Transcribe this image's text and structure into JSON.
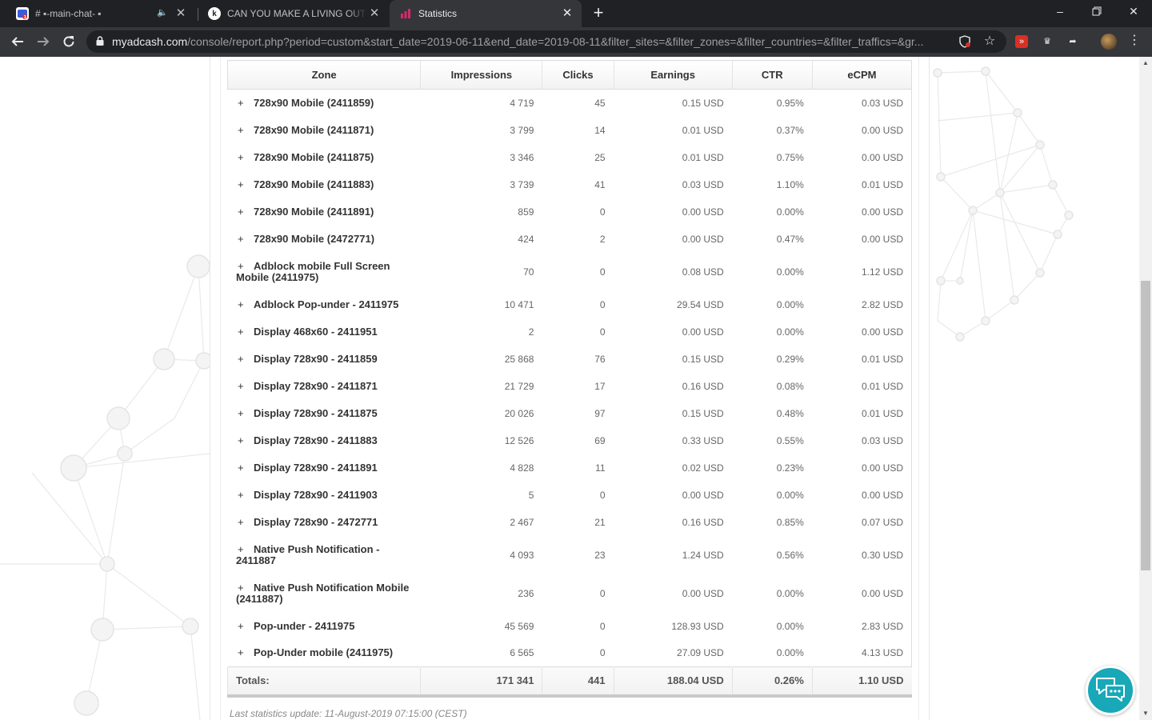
{
  "browser": {
    "tabs": [
      {
        "title": "# ▪-main-chat- ▪",
        "favicon": "discord-icon",
        "has_audio": true
      },
      {
        "title": "CAN YOU MAKE A LIVING OUT O",
        "favicon": "k-icon"
      },
      {
        "title": "Statistics",
        "favicon": "bar-chart-icon",
        "active": true
      }
    ],
    "new_tab": "+",
    "window": {
      "minimize": "–",
      "maximize": "❐",
      "close": "✕"
    },
    "url": {
      "domain": "myadcash.com",
      "path": "/console/report.php?period=custom&start_date=2019-06-11&end_date=2019-08-11&filter_sites=&filter_zones=&filter_countries=&filter_traffics=&gr..."
    }
  },
  "report": {
    "headers": [
      "Zone",
      "Impressions",
      "Clicks",
      "Earnings",
      "CTR",
      "eCPM"
    ],
    "expand_symbol": "+",
    "rows": [
      {
        "zone": "728x90 Mobile (2411859)",
        "impressions": "4 719",
        "clicks": "45",
        "earnings": "0.15 USD",
        "ctr": "0.95%",
        "ecpm": "0.03 USD"
      },
      {
        "zone": "728x90 Mobile (2411871)",
        "impressions": "3 799",
        "clicks": "14",
        "earnings": "0.01 USD",
        "ctr": "0.37%",
        "ecpm": "0.00 USD"
      },
      {
        "zone": "728x90 Mobile (2411875)",
        "impressions": "3 346",
        "clicks": "25",
        "earnings": "0.01 USD",
        "ctr": "0.75%",
        "ecpm": "0.00 USD"
      },
      {
        "zone": "728x90 Mobile (2411883)",
        "impressions": "3 739",
        "clicks": "41",
        "earnings": "0.03 USD",
        "ctr": "1.10%",
        "ecpm": "0.01 USD"
      },
      {
        "zone": "728x90 Mobile (2411891)",
        "impressions": "859",
        "clicks": "0",
        "earnings": "0.00 USD",
        "ctr": "0.00%",
        "ecpm": "0.00 USD"
      },
      {
        "zone": "728x90 Mobile (2472771)",
        "impressions": "424",
        "clicks": "2",
        "earnings": "0.00 USD",
        "ctr": "0.47%",
        "ecpm": "0.00 USD"
      },
      {
        "zone": "Adblock mobile Full Screen Mobile (2411975)",
        "impressions": "70",
        "clicks": "0",
        "earnings": "0.08 USD",
        "ctr": "0.00%",
        "ecpm": "1.12 USD",
        "tall": true
      },
      {
        "zone": "Adblock Pop-under - 2411975",
        "impressions": "10 471",
        "clicks": "0",
        "earnings": "29.54 USD",
        "ctr": "0.00%",
        "ecpm": "2.82 USD"
      },
      {
        "zone": "Display 468x60 - 2411951",
        "impressions": "2",
        "clicks": "0",
        "earnings": "0.00 USD",
        "ctr": "0.00%",
        "ecpm": "0.00 USD"
      },
      {
        "zone": "Display 728x90 - 2411859",
        "impressions": "25 868",
        "clicks": "76",
        "earnings": "0.15 USD",
        "ctr": "0.29%",
        "ecpm": "0.01 USD"
      },
      {
        "zone": "Display 728x90 - 2411871",
        "impressions": "21 729",
        "clicks": "17",
        "earnings": "0.16 USD",
        "ctr": "0.08%",
        "ecpm": "0.01 USD"
      },
      {
        "zone": "Display 728x90 - 2411875",
        "impressions": "20 026",
        "clicks": "97",
        "earnings": "0.15 USD",
        "ctr": "0.48%",
        "ecpm": "0.01 USD"
      },
      {
        "zone": "Display 728x90 - 2411883",
        "impressions": "12 526",
        "clicks": "69",
        "earnings": "0.33 USD",
        "ctr": "0.55%",
        "ecpm": "0.03 USD"
      },
      {
        "zone": "Display 728x90 - 2411891",
        "impressions": "4 828",
        "clicks": "11",
        "earnings": "0.02 USD",
        "ctr": "0.23%",
        "ecpm": "0.00 USD"
      },
      {
        "zone": "Display 728x90 - 2411903",
        "impressions": "5",
        "clicks": "0",
        "earnings": "0.00 USD",
        "ctr": "0.00%",
        "ecpm": "0.00 USD"
      },
      {
        "zone": "Display 728x90 - 2472771",
        "impressions": "2 467",
        "clicks": "21",
        "earnings": "0.16 USD",
        "ctr": "0.85%",
        "ecpm": "0.07 USD"
      },
      {
        "zone": "Native Push Notification - 2411887",
        "impressions": "4 093",
        "clicks": "23",
        "earnings": "1.24 USD",
        "ctr": "0.56%",
        "ecpm": "0.30 USD",
        "tall": true
      },
      {
        "zone": "Native Push Notification Mobile (2411887)",
        "impressions": "236",
        "clicks": "0",
        "earnings": "0.00 USD",
        "ctr": "0.00%",
        "ecpm": "0.00 USD",
        "tall": true
      },
      {
        "zone": "Pop-under - 2411975",
        "impressions": "45 569",
        "clicks": "0",
        "earnings": "128.93 USD",
        "ctr": "0.00%",
        "ecpm": "2.83 USD"
      },
      {
        "zone": "Pop-Under mobile (2411975)",
        "impressions": "6 565",
        "clicks": "0",
        "earnings": "27.09 USD",
        "ctr": "0.00%",
        "ecpm": "4.13 USD"
      }
    ],
    "totals": {
      "label": "Totals:",
      "impressions": "171 341",
      "clicks": "441",
      "earnings": "188.04 USD",
      "ctr": "0.26%",
      "ecpm": "1.10 USD"
    },
    "last_update": "Last statistics update: 11-August-2019 07:15:00 (CEST)"
  },
  "colors": {
    "chrome_dark": "#202124",
    "chrome_toolbar": "#35363a",
    "chat_accent": "#18a8b8",
    "zone_tab_icon": "#d6286f"
  }
}
